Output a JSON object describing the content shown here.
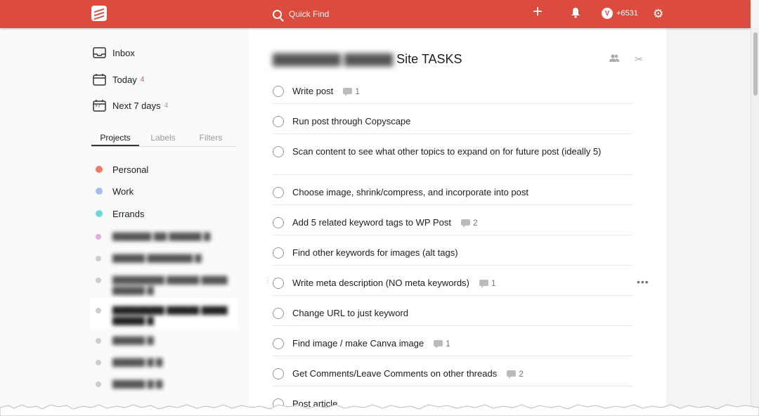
{
  "topbar": {
    "search_placeholder": "Quick Find",
    "karma": "+6531",
    "bg_color": "#db4c3f"
  },
  "nav": {
    "inbox": "Inbox",
    "today": "Today",
    "today_count": "4",
    "next7": "Next 7 days",
    "next7_count": "4",
    "calendar_badge": "+7"
  },
  "tabs": [
    "Projects",
    "Labels",
    "Filters"
  ],
  "projects": [
    {
      "name": "Personal",
      "color": "#f07b6b"
    },
    {
      "name": "Work",
      "color": "#a3c1e8"
    },
    {
      "name": "Errands",
      "color": "#6fd8d8"
    }
  ],
  "icons": [
    "search-icon",
    "plus-icon",
    "bell-icon",
    "settings-icon",
    "inbox-icon",
    "calendar-icon",
    "people-icon",
    "settings-tools-icon",
    "comment-icon",
    "more-icon"
  ],
  "main": {
    "title": "Site TASKS",
    "tasks": [
      {
        "text": "Write post",
        "comments": "1"
      },
      {
        "text": "Run post through Copyscape",
        "comments": ""
      },
      {
        "text": "Scan content to see what other topics to expand on for future post (ideally 5)",
        "comments": ""
      },
      {
        "text": "Choose image, shrink/compress, and incorporate into post",
        "comments": ""
      },
      {
        "text": "Add 5 related keyword tags to WP Post",
        "comments": "2"
      },
      {
        "text": "Find other keywords for images (alt tags)",
        "comments": ""
      },
      {
        "text": "Write meta description (NO meta keywords)",
        "comments": "1"
      },
      {
        "text": "Change URL to just keyword",
        "comments": ""
      },
      {
        "text": "Find image / make Canva image",
        "comments": "1"
      },
      {
        "text": "Get Comments/Leave Comments on other threads",
        "comments": "2"
      },
      {
        "text": "Post article",
        "comments": ""
      }
    ]
  }
}
